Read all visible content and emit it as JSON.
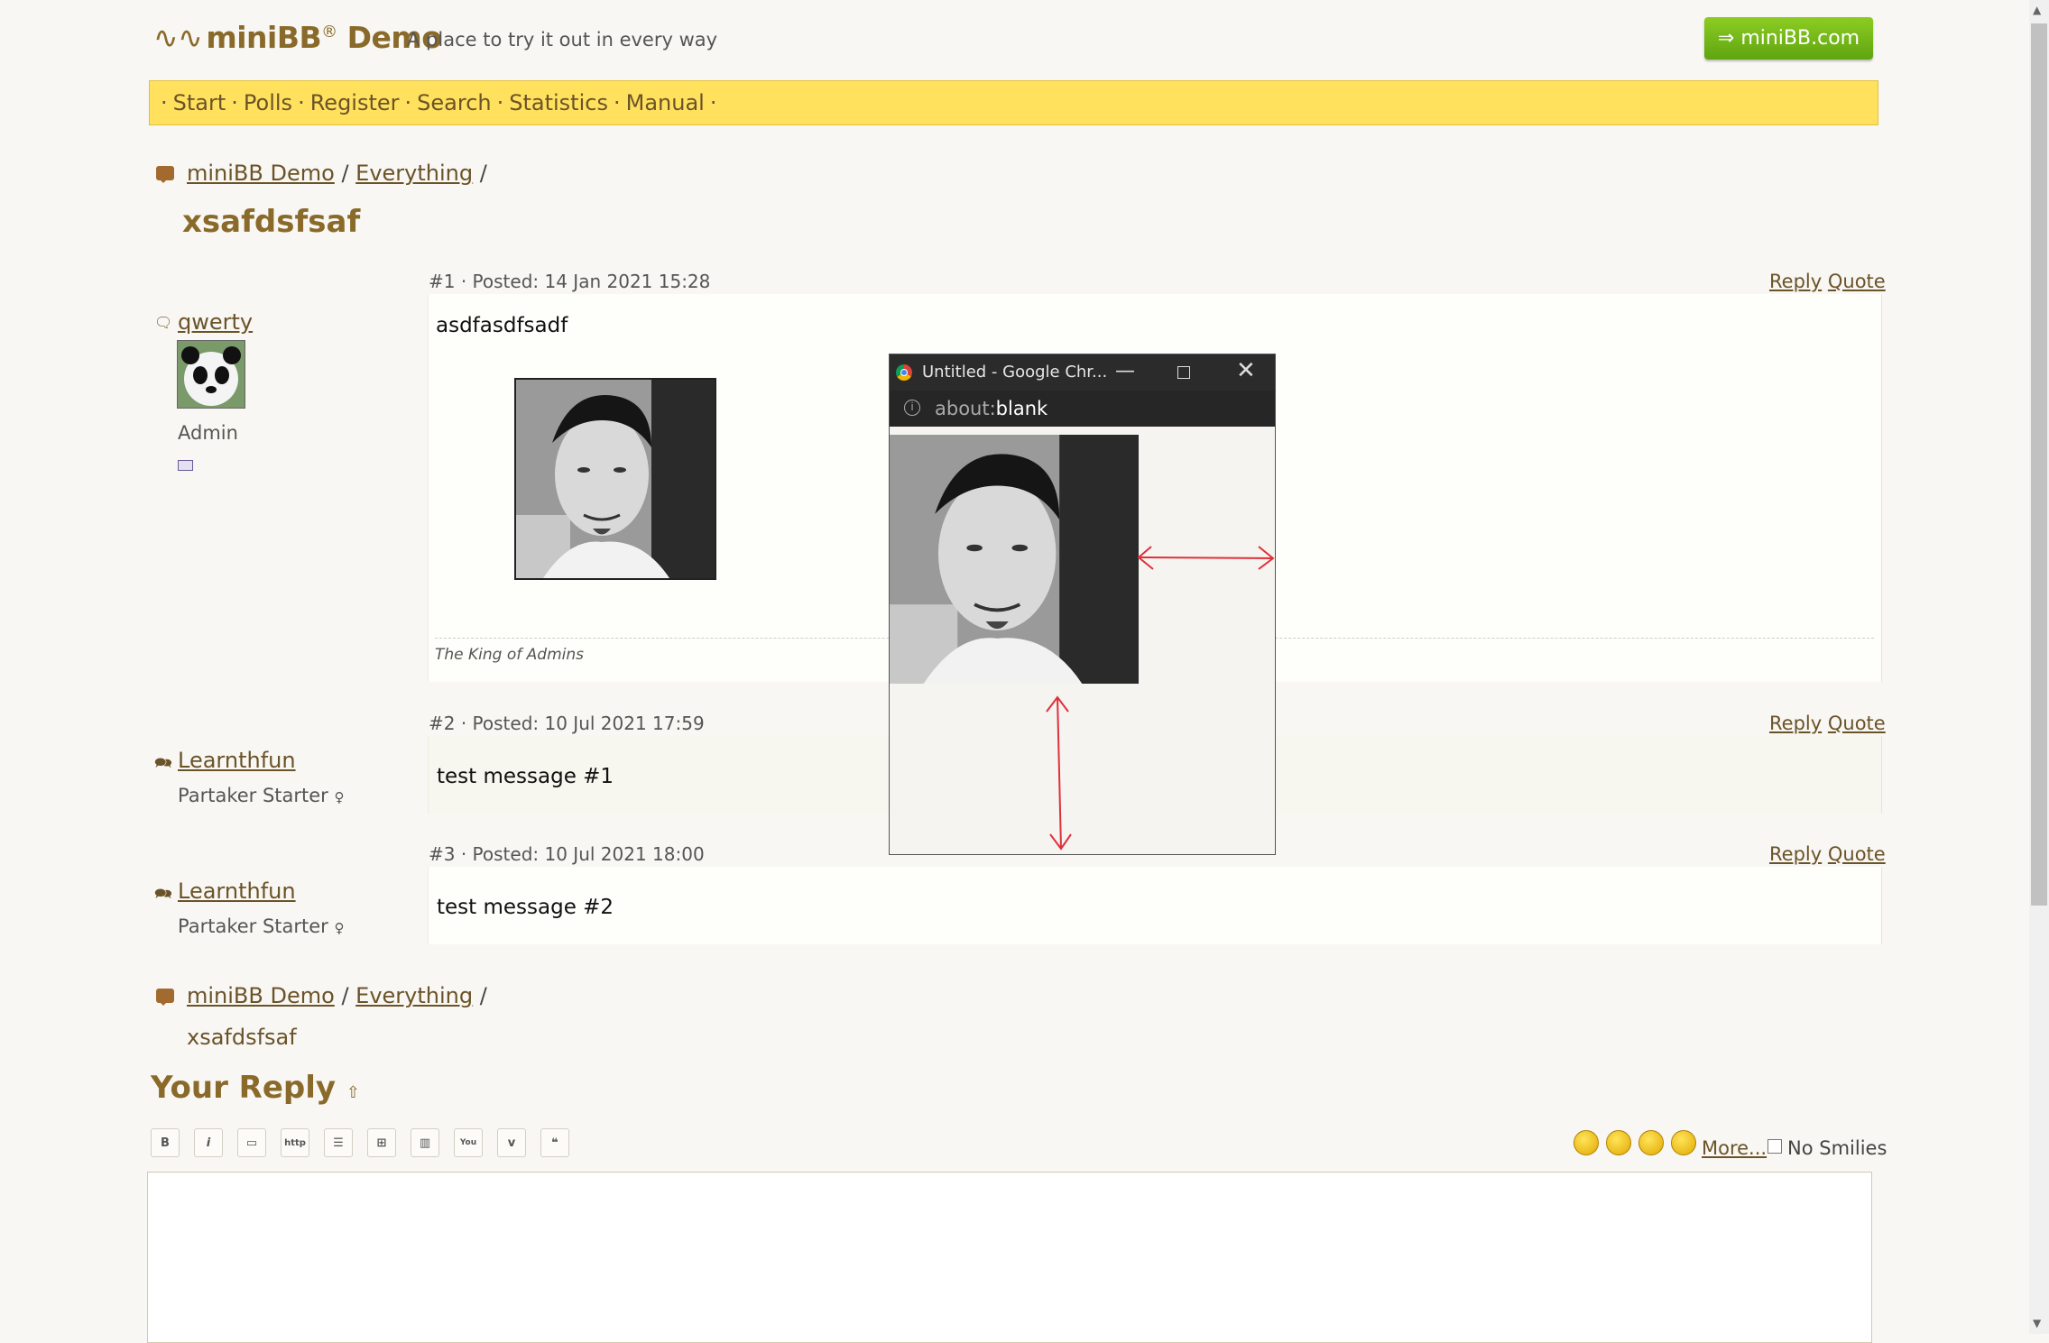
{
  "header": {
    "logo_text": "miniBB",
    "logo_reg": "®",
    "logo_suffix": "Demo",
    "tagline": "A place to try it out in every way",
    "site_button": "⇒ miniBB.com"
  },
  "nav": {
    "items": [
      "Start",
      "Polls",
      "Register",
      "Search",
      "Statistics",
      "Manual"
    ],
    "separator": "·"
  },
  "breadcrumb": {
    "forum": "miniBB Demo",
    "category": "Everything",
    "sep": "/",
    "topic": "xsafdsfsaf"
  },
  "posts": [
    {
      "meta": "#1 · Posted: 14 Jan 2021 15:28",
      "reply": "Reply",
      "quote": "Quote",
      "author": "qwerty",
      "role": "Admin",
      "message": "asdfasdfsadf",
      "signature": "The King of Admins"
    },
    {
      "meta": "#2 · Posted: 10 Jul 2021 17:59",
      "reply": "Reply",
      "quote": "Quote",
      "author": "Learnthfun",
      "role": "Partaker Starter",
      "role_icon": "♀",
      "message": "test message #1"
    },
    {
      "meta": "#3 · Posted: 10 Jul 2021 18:00",
      "reply": "Reply",
      "quote": "Quote",
      "author": "Learnthfun",
      "role": "Partaker Starter",
      "role_icon": "♀",
      "message": "test message #2"
    }
  ],
  "popup": {
    "title": "Untitled - Google Chr...",
    "address_prefix": "about:",
    "address_main": "blank"
  },
  "reply": {
    "title": "Your Reply",
    "toolbar": [
      "B",
      "i",
      "img",
      "http",
      "list",
      "grid",
      "chart",
      "You",
      "v",
      "quote"
    ],
    "more_link": "More...",
    "no_smilies": "No Smilies"
  },
  "colors": {
    "accent": "#8a6a2a",
    "nav_bg": "#ffe15d",
    "button_green": "#6fb516",
    "annotation_red": "#e0303a"
  }
}
